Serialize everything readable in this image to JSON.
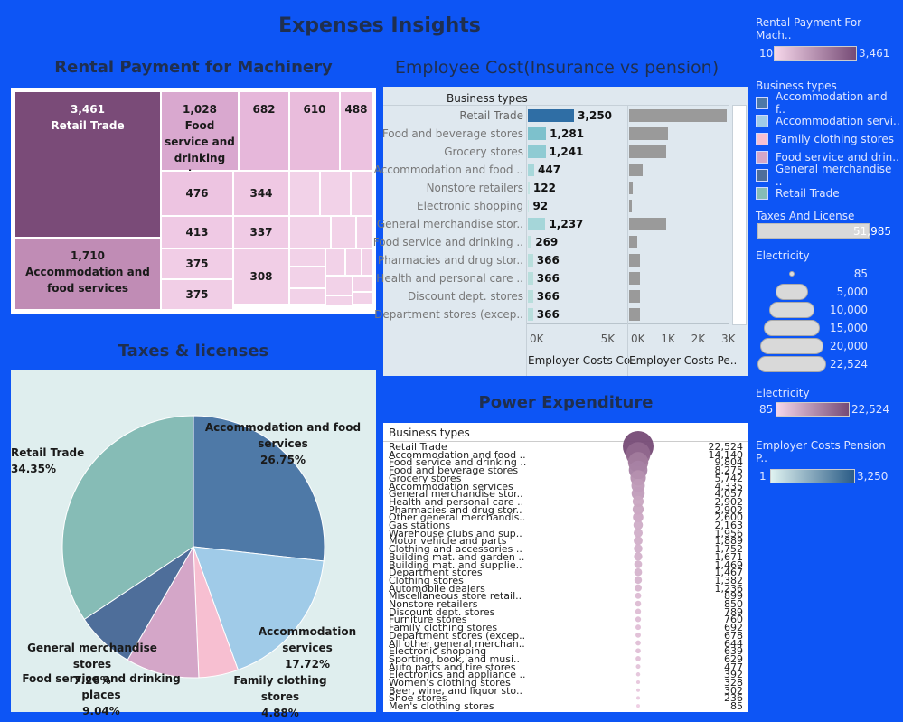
{
  "dashboard": {
    "title": "Expenses Insights"
  },
  "rental": {
    "title": "Rental Payment for Machinery",
    "cells": [
      {
        "value": "3,461",
        "label": "Retail Trade"
      },
      {
        "value": "1,710",
        "label": "Accommodation and food services"
      },
      {
        "value": "1,028",
        "label": "Food service and drinking places"
      },
      {
        "value": "682",
        "label": ""
      },
      {
        "value": "610",
        "label": ""
      },
      {
        "value": "488",
        "label": ""
      },
      {
        "value": "476",
        "label": ""
      },
      {
        "value": "344",
        "label": ""
      },
      {
        "value": "413",
        "label": ""
      },
      {
        "value": "337",
        "label": ""
      },
      {
        "value": "375",
        "label": ""
      },
      {
        "value": "308",
        "label": ""
      },
      {
        "value": "375",
        "label": ""
      }
    ]
  },
  "employee": {
    "title": "Employee Cost(Insurance vs pension)",
    "header": "Business types",
    "axis1_ticks": [
      "0K",
      "5K"
    ],
    "axis2_ticks": [
      "0K",
      "1K",
      "2K",
      "3K"
    ],
    "axis1_label": "Employer Costs Co..",
    "axis2_label": "Employer Costs Pe.."
  },
  "taxes": {
    "title": "Taxes & licenses"
  },
  "power": {
    "title": "Power Expenditure",
    "header": "Business types"
  },
  "legends": {
    "rental": {
      "title": "Rental Payment For Mach..",
      "min": "10",
      "max": "3,461"
    },
    "business_title": "Business types",
    "business_items": [
      {
        "label": "Accommodation and f..",
        "color": "#4e79a7"
      },
      {
        "label": "Accommodation servi..",
        "color": "#a0cbe8"
      },
      {
        "label": "Family clothing stores",
        "color": "#f7bfd1"
      },
      {
        "label": "Food service and drin..",
        "color": "#d4a6c8"
      },
      {
        "label": "General merchandise ..",
        "color": "#4e6e9a"
      },
      {
        "label": "Retail Trade",
        "color": "#86bcb6"
      }
    ],
    "taxes": {
      "title": "Taxes And License",
      "value": "51,985"
    },
    "electricity_size": {
      "title": "Electricity",
      "labels": [
        "85",
        "5,000",
        "10,000",
        "15,000",
        "20,000",
        "22,524"
      ]
    },
    "electricity_color": {
      "title": "Electricity",
      "min": "85",
      "max": "22,524"
    },
    "pension": {
      "title": "Employer Costs Pension P..",
      "min": "1",
      "max": "3,250"
    }
  },
  "chart_data": [
    {
      "type": "treemap",
      "title": "Rental Payment for Machinery",
      "categories": [
        "Retail Trade",
        "Accommodation and food services",
        "Food service and drinking places"
      ],
      "values": [
        3461,
        1710,
        1028,
        682,
        610,
        488,
        476,
        413,
        375,
        375,
        344,
        337,
        308
      ]
    },
    {
      "type": "bar",
      "title": "Employee Cost(Insurance vs pension)",
      "categories": [
        "Retail Trade",
        "Food and beverage stores",
        "Grocery stores",
        "Accommodation and food ..",
        "Nonstore retailers",
        "Electronic shopping",
        "General merchandise stor..",
        "Food service and drinking ..",
        "Pharmacies and drug stor..",
        "Health and personal care ..",
        "Discount dept. stores",
        "Department stores (excep.."
      ],
      "series": [
        {
          "name": "Employer Costs Co..",
          "values": [
            3250,
            1281,
            1241,
            447,
            122,
            92,
            1237,
            269,
            366,
            366,
            366,
            366
          ]
        },
        {
          "name": "Employer Costs Pe..",
          "values": [
            3250,
            1281,
            1241,
            447,
            122,
            92,
            1237,
            269,
            366,
            366,
            366,
            366
          ]
        }
      ],
      "xlim1": [
        0,
        7000
      ],
      "xlim2": [
        0,
        3300
      ]
    },
    {
      "type": "pie",
      "title": "Taxes & licenses",
      "categories": [
        "Accommodation and food services",
        "Accommodation services",
        "Family clothing stores",
        "Food service and drinking places",
        "General merchandise stores",
        "Retail Trade"
      ],
      "values": [
        26.75,
        17.72,
        4.88,
        9.04,
        7.26,
        34.35
      ],
      "labels": [
        "26.75%",
        "17.72%",
        "4.88%",
        "9.04%",
        "7.26%",
        "34.35%"
      ],
      "colors": [
        "#4e79a7",
        "#a0cbe8",
        "#f7bfd1",
        "#d4a6c8",
        "#4e6e9a",
        "#86bcb6"
      ]
    },
    {
      "type": "bubble",
      "title": "Power Expenditure",
      "categories": [
        "Retail Trade",
        "Accommodation and food ..",
        "Food service and drinking ..",
        "Food and beverage stores",
        "Grocery stores",
        "Accommodation services",
        "General merchandise stor..",
        "Health and personal care ..",
        "Pharmacies and drug stor..",
        "Other general merchandis..",
        "Gas stations",
        "Warehouse clubs and sup..",
        "Motor vehicle and parts",
        "Clothing and accessories ..",
        "Building mat. and garden ..",
        "Building mat. and supplie..",
        "Department stores",
        "Clothing stores",
        "Automobile dealers",
        "Miscellaneous store retail..",
        "Nonstore retailers",
        "Discount dept. stores",
        "Furniture stores",
        "Family clothing stores",
        "Department stores (excep..",
        "All other general merchan..",
        "Electronic shopping",
        "Sporting, book, and musi..",
        "Auto parts and tire stores",
        "Electronics and appliance ..",
        "Women's clothing stores",
        "Beer, wine, and liquor sto..",
        "Shoe stores",
        "Men's clothing stores"
      ],
      "values": [
        22524,
        14140,
        9804,
        8275,
        5742,
        4335,
        4057,
        2902,
        2902,
        2600,
        2163,
        1956,
        1889,
        1752,
        1671,
        1469,
        1467,
        1382,
        1236,
        899,
        850,
        789,
        760,
        692,
        678,
        644,
        639,
        629,
        477,
        392,
        328,
        302,
        236,
        85
      ],
      "labels": [
        "22,524",
        "14,140",
        "9,804",
        "8,275",
        "5,742",
        "4,335",
        "4,057",
        "2,902",
        "2,902",
        "2,600",
        "2,163",
        "1,956",
        "1,889",
        "1,752",
        "1,671",
        "1,469",
        "1,467",
        "1,382",
        "1,236",
        "899",
        "850",
        "789",
        "760",
        "692",
        "678",
        "644",
        "639",
        "629",
        "477",
        "392",
        "328",
        "302",
        "236",
        "85"
      ]
    }
  ]
}
